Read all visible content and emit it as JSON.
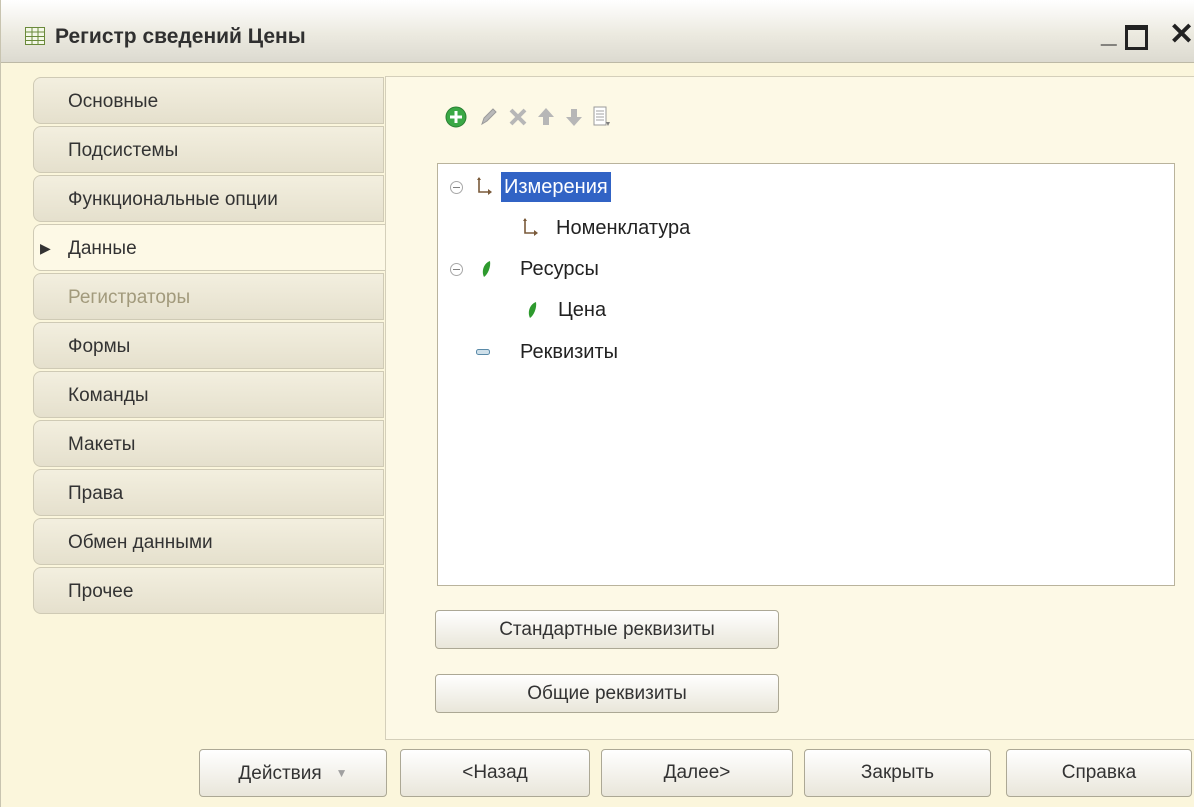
{
  "window": {
    "title": "Регистр сведений Цены",
    "minimize": "_",
    "close": "✕"
  },
  "tabs": [
    {
      "label": "Основные"
    },
    {
      "label": "Подсистемы"
    },
    {
      "label": "Функциональные опции"
    },
    {
      "label": "Данные",
      "active": true
    },
    {
      "label": "Регистраторы",
      "disabled": true
    },
    {
      "label": "Формы"
    },
    {
      "label": "Команды"
    },
    {
      "label": "Макеты"
    },
    {
      "label": "Права"
    },
    {
      "label": "Обмен данными"
    },
    {
      "label": "Прочее"
    }
  ],
  "toolbar": {
    "icons": [
      "add-icon",
      "edit-icon",
      "delete-icon",
      "move-up-icon",
      "move-down-icon",
      "list-icon"
    ]
  },
  "tree": {
    "dimensions_label": "Измерения",
    "dimension_item": "Номенклатура",
    "resources_label": "Ресурсы",
    "resource_item": "Цена",
    "attributes_label": "Реквизиты"
  },
  "panel_buttons": {
    "standard_attributes": "Стандартные реквизиты",
    "common_attributes": "Общие реквизиты"
  },
  "footer": {
    "actions": "Действия",
    "back": "<Назад",
    "next": "Далее>",
    "close": "Закрыть",
    "help": "Справка"
  },
  "colors": {
    "selection": "#3163c5",
    "window_bg": "#fbf6dc",
    "add_green": "#3aa845",
    "resource_green": "#2e9a2e"
  }
}
